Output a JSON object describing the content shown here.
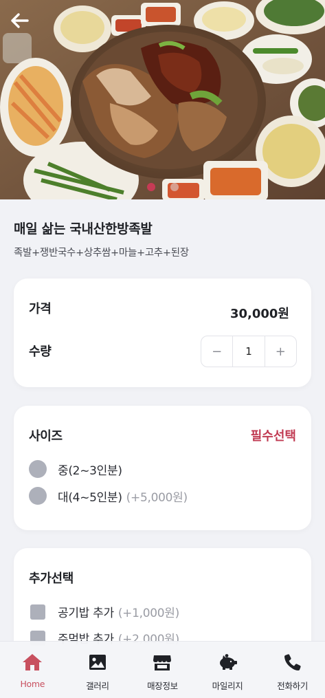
{
  "product": {
    "name": "매일 삶는 국내산한방족발",
    "description": "족발+쟁반국수+상추쌈+마늘+고추+된장"
  },
  "carousel": {
    "total": 2,
    "active_index": 0
  },
  "price_card": {
    "price_label": "가격",
    "price_value": "30,000원",
    "quantity_label": "수량",
    "quantity": "1",
    "minus": "−",
    "plus": "+"
  },
  "size_card": {
    "title": "사이즈",
    "required_label": "필수선택",
    "options": [
      {
        "label": "중(2~3인분)",
        "extra": ""
      },
      {
        "label": "대(4~5인분)",
        "extra": "(+5,000원)"
      }
    ]
  },
  "extra_card": {
    "title": "추가선택",
    "options": [
      {
        "label": "공기밥 추가",
        "extra": "(+1,000원)"
      },
      {
        "label": "주먹밥 추가",
        "extra": "(+2,000원)"
      }
    ]
  },
  "nav": {
    "items": [
      {
        "label": "Home",
        "icon": "home-icon",
        "active": true
      },
      {
        "label": "갤러리",
        "icon": "gallery-icon",
        "active": false
      },
      {
        "label": "매장정보",
        "icon": "store-icon",
        "active": false
      },
      {
        "label": "마일리지",
        "icon": "piggy-bank-icon",
        "active": false
      },
      {
        "label": "전화하기",
        "icon": "phone-icon",
        "active": false
      }
    ]
  },
  "colors": {
    "accent": "#c03a52",
    "nav_active": "#c8505f",
    "background": "#f1f2f6",
    "option_marker": "#adb0ba"
  }
}
